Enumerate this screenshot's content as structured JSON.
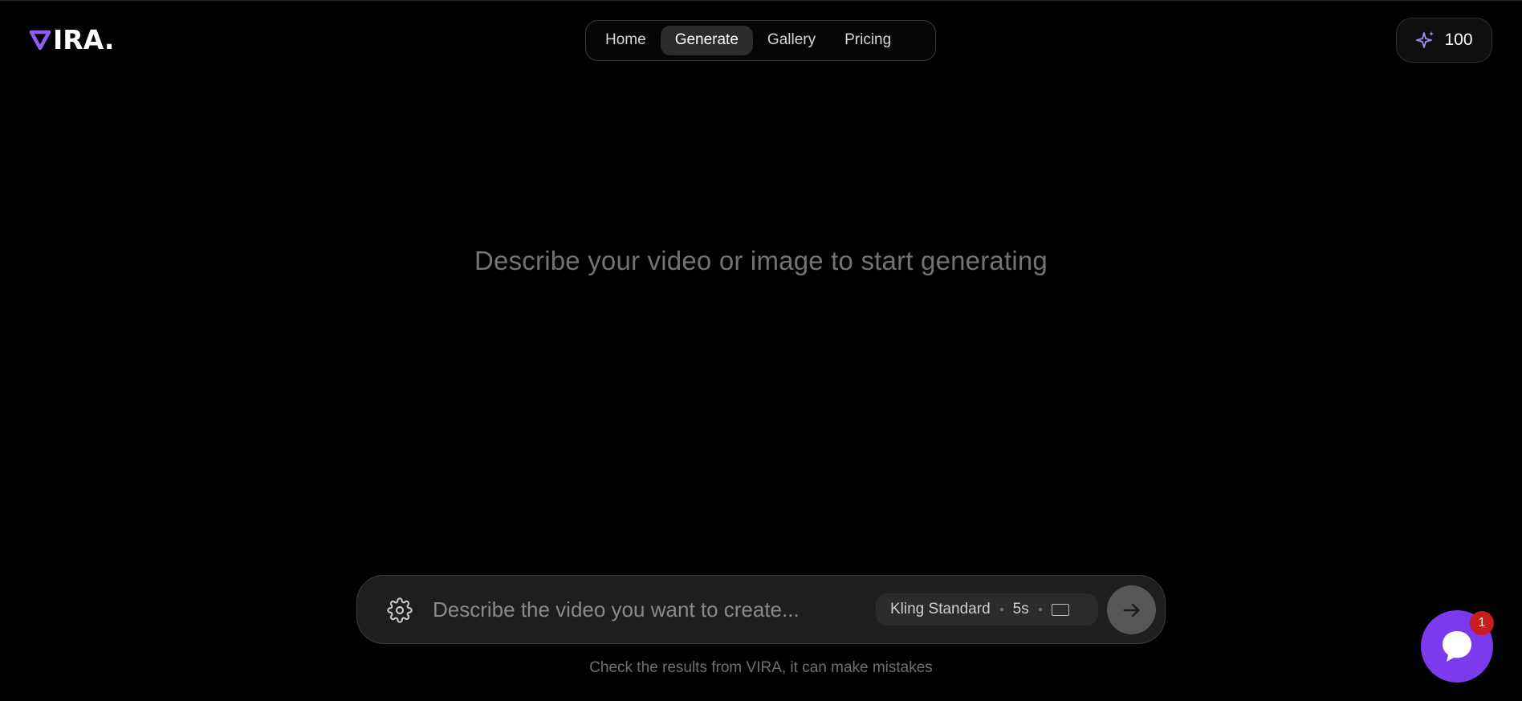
{
  "brand": {
    "name": "IRA.",
    "accent_color": "#8b5cf6",
    "logo_icon": "v-triangle-logo-icon"
  },
  "nav": {
    "items": [
      {
        "label": "Home",
        "active": false
      },
      {
        "label": "Generate",
        "active": true
      },
      {
        "label": "Gallery",
        "active": false
      },
      {
        "label": "Pricing",
        "active": false
      }
    ]
  },
  "credits": {
    "icon": "sparkle-icon",
    "value": "100"
  },
  "hero": {
    "message": "Describe your video or image to start generating"
  },
  "composer": {
    "settings_icon": "gear-icon",
    "placeholder": "Describe the video you want to create...",
    "value": "",
    "model": "Kling Standard",
    "duration": "5s",
    "aspect_icon": "aspect-ratio-icon",
    "send_icon": "arrow-right-icon"
  },
  "disclaimer": "Check the results from VIRA, it can make mistakes",
  "chat": {
    "icon": "chat-bubble-icon",
    "badge_count": "1",
    "color": "#7c3aed",
    "badge_color": "#c81e1e"
  }
}
